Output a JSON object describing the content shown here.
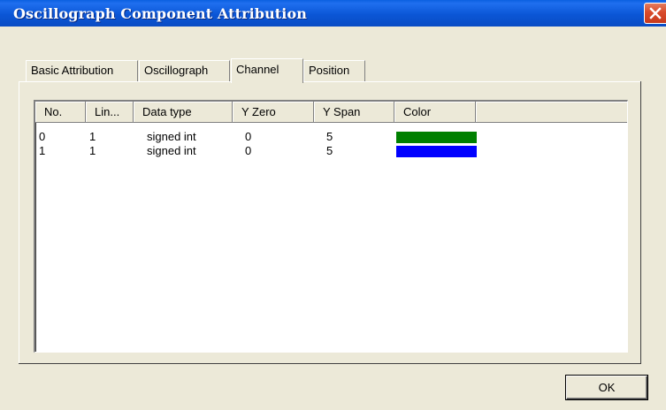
{
  "window": {
    "title": "Oscillograph Component Attribution",
    "close_icon": "close-icon"
  },
  "tabs": [
    {
      "label": "Basic Attribution",
      "active": false
    },
    {
      "label": "Oscillograph",
      "active": false
    },
    {
      "label": "Channel",
      "active": true
    },
    {
      "label": "Position",
      "active": false
    }
  ],
  "channel_list": {
    "columns": [
      "No.",
      "Lin...",
      "Data type",
      "Y Zero",
      "Y Span",
      "Color"
    ],
    "rows": [
      {
        "no": "0",
        "line": "1",
        "data_type": "signed int",
        "y_zero": "0",
        "y_span": "5",
        "color": "#008000"
      },
      {
        "no": "1",
        "line": "1",
        "data_type": "signed int",
        "y_zero": "0",
        "y_span": "5",
        "color": "#0000ff"
      }
    ]
  },
  "buttons": {
    "ok_label": "OK"
  }
}
